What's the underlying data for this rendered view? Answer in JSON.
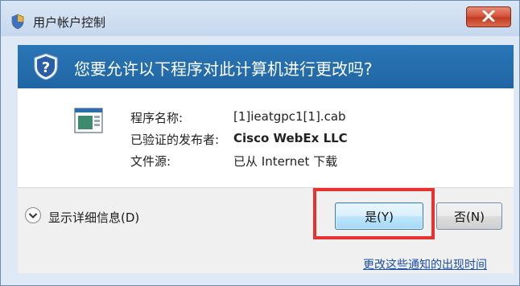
{
  "window": {
    "title": "用户帐户控制"
  },
  "banner": {
    "question": "您要允许以下程序对此计算机进行更改吗?"
  },
  "details": {
    "program_label": "程序名称:",
    "program_value": "[1]ieatgpc1[1].cab",
    "publisher_label": "已验证的发布者:",
    "publisher_value": "Cisco WebEx LLC",
    "source_label": "文件源:",
    "source_value": "已从 Internet 下载"
  },
  "footer": {
    "show_details": "显示详细信息(D)",
    "yes_button": "是(Y)",
    "no_button": "否(N)",
    "link": "更改这些通知的出现时间"
  },
  "colors": {
    "banner": "#2065a3",
    "highlight": "#e8322f",
    "link": "#1a50a8"
  },
  "icons": [
    "shield-icon",
    "question-shield-icon",
    "program-icon",
    "close-icon",
    "chevron-down-icon"
  ]
}
